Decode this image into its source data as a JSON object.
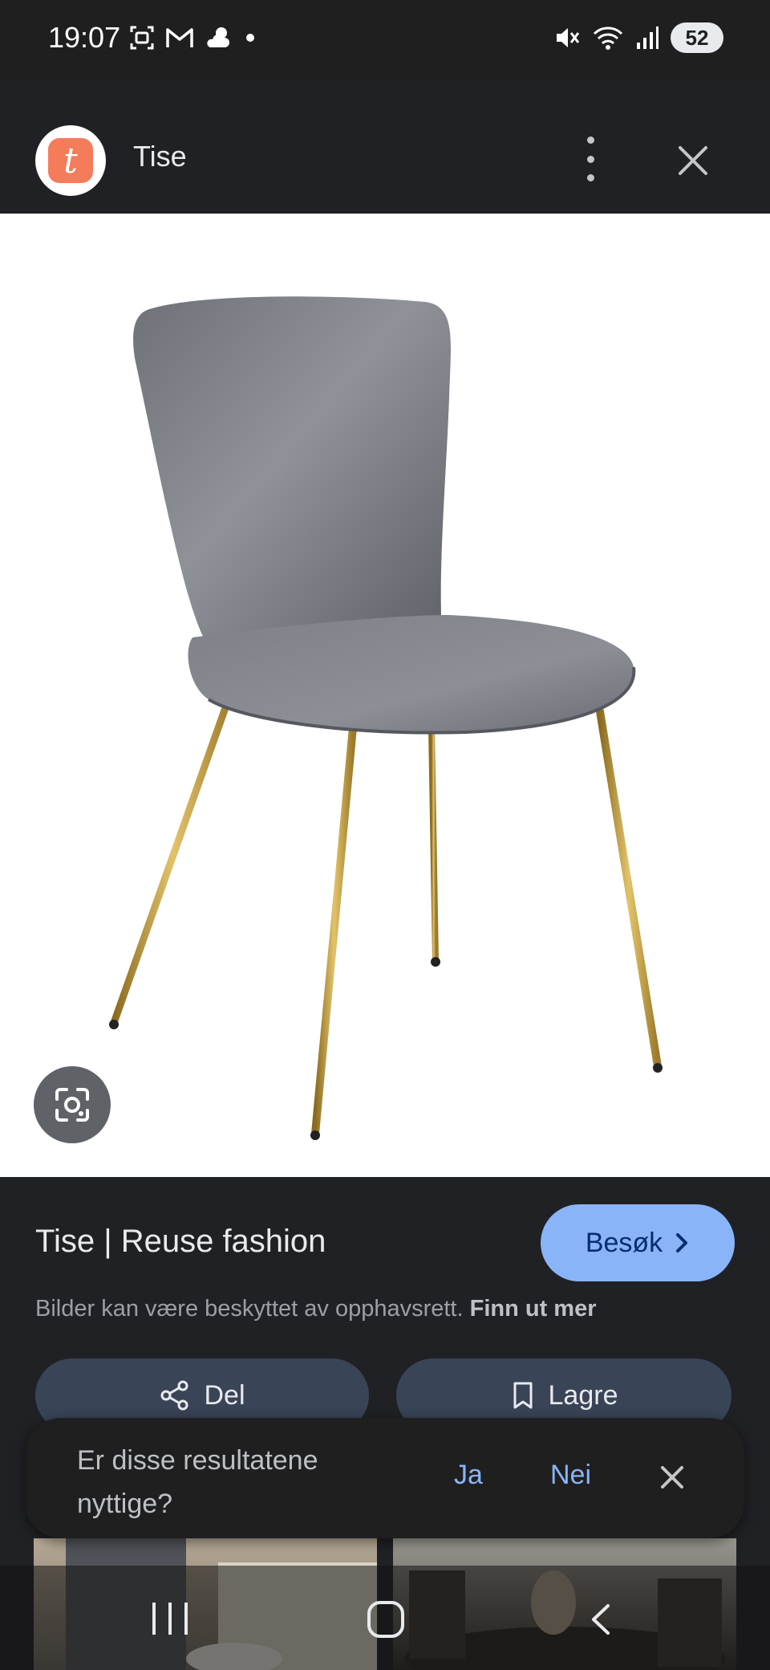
{
  "status_bar": {
    "time": "19:07",
    "left_icons": [
      "screenshot-icon",
      "gmail-icon",
      "weather-icon",
      "dot-icon"
    ],
    "right_icons": [
      "mute-icon",
      "wifi-6e-icon",
      "signal-icon"
    ],
    "battery": "52"
  },
  "header": {
    "app_logo_letter": "t",
    "app_name": "Tise",
    "menu_icon": "more-vert-icon",
    "close_icon": "close-icon"
  },
  "image": {
    "subject": "grey velvet chair with gold legs",
    "lens_icon": "google-lens-icon"
  },
  "info": {
    "source_title": "Tise | Reuse fashion",
    "visit_label": "Besøk",
    "copyright_text": "Bilder kan være beskyttet av opphavsrett.",
    "copyright_link": "Finn ut mer",
    "share_label": "Del",
    "save_label": "Lagre"
  },
  "feedback": {
    "question": "Er disse resultatene nyttige?",
    "yes_label": "Ja",
    "no_label": "Nei"
  },
  "colors": {
    "accent": "#8ab4f8",
    "background": "#202124",
    "button_bg": "#394457",
    "brand": "#f57c5a"
  }
}
